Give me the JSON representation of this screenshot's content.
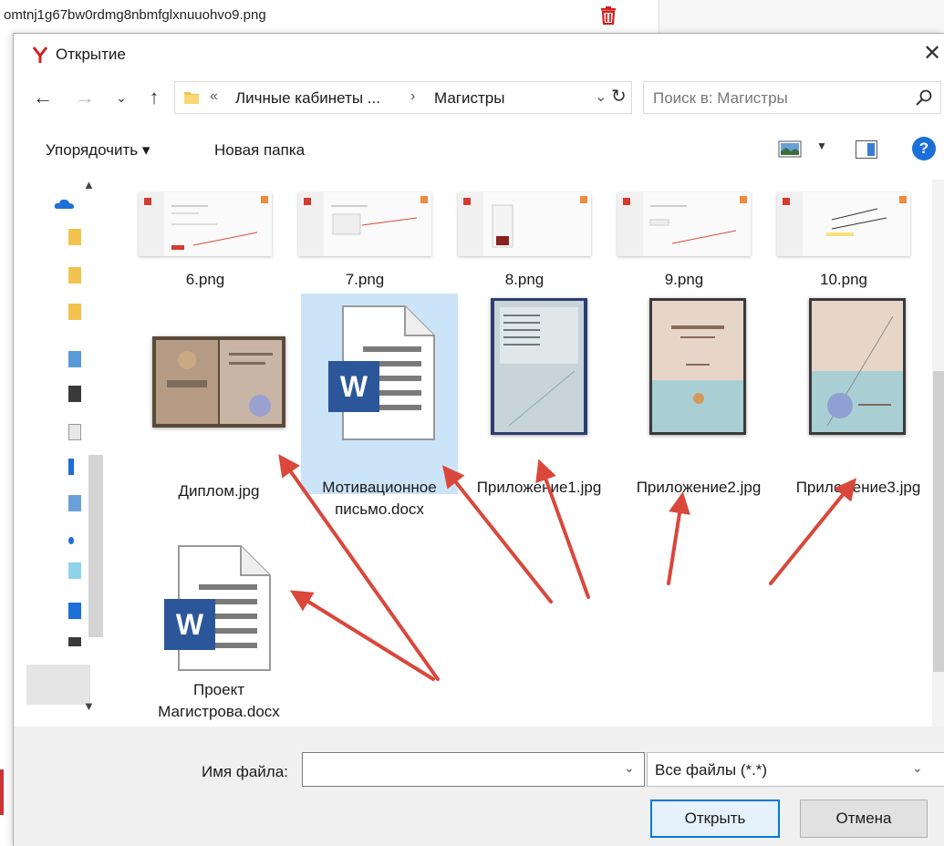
{
  "background": {
    "filename": "omtnj1g67bw0rdmg8nbmfglxnuuohvo9.png"
  },
  "dialog": {
    "title": "Открытие",
    "close_glyph": "✕",
    "brand_color": "#d4201f"
  },
  "nav": {
    "back_glyph": "←",
    "forward_glyph": "→",
    "recent_glyph": "⌄",
    "up_glyph": "↑",
    "breadcrumb": [
      "Личные кабинеты ...",
      "Магистры"
    ],
    "overflow_glyph": "«",
    "sep_glyph": "›",
    "dropdown_glyph": "⌄",
    "refresh_glyph": "↻",
    "search_placeholder": "Поиск в: Магистры"
  },
  "toolbar": {
    "organize": "Упорядочить ▾",
    "new_folder": "Новая папка",
    "help": "?"
  },
  "files": {
    "row1": [
      "6.png",
      "7.png",
      "8.png",
      "9.png",
      "10.png"
    ],
    "row2": [
      {
        "name": "Диплом.jpg",
        "type": "image"
      },
      {
        "name": "Мотивационное письмо.docx",
        "type": "word"
      },
      {
        "name": "Приложение1.jpg",
        "type": "image"
      },
      {
        "name": "Приложение2.jpg",
        "type": "image"
      },
      {
        "name": "Приложение3.jpg",
        "type": "image"
      }
    ],
    "row3": [
      {
        "name": "Проект Магистрова.docx",
        "type": "word"
      }
    ],
    "word_letter": "W"
  },
  "footer": {
    "filename_label": "Имя файла:",
    "filename_value": "",
    "filetype_value": "Все файлы (*.*)",
    "open_button": "Открыть",
    "cancel_button": "Отмена"
  },
  "colors": {
    "annotation_arrow": "#d9483b",
    "word_blue": "#2b579a",
    "selection": "#cce4f7",
    "accent": "#0078d7"
  }
}
